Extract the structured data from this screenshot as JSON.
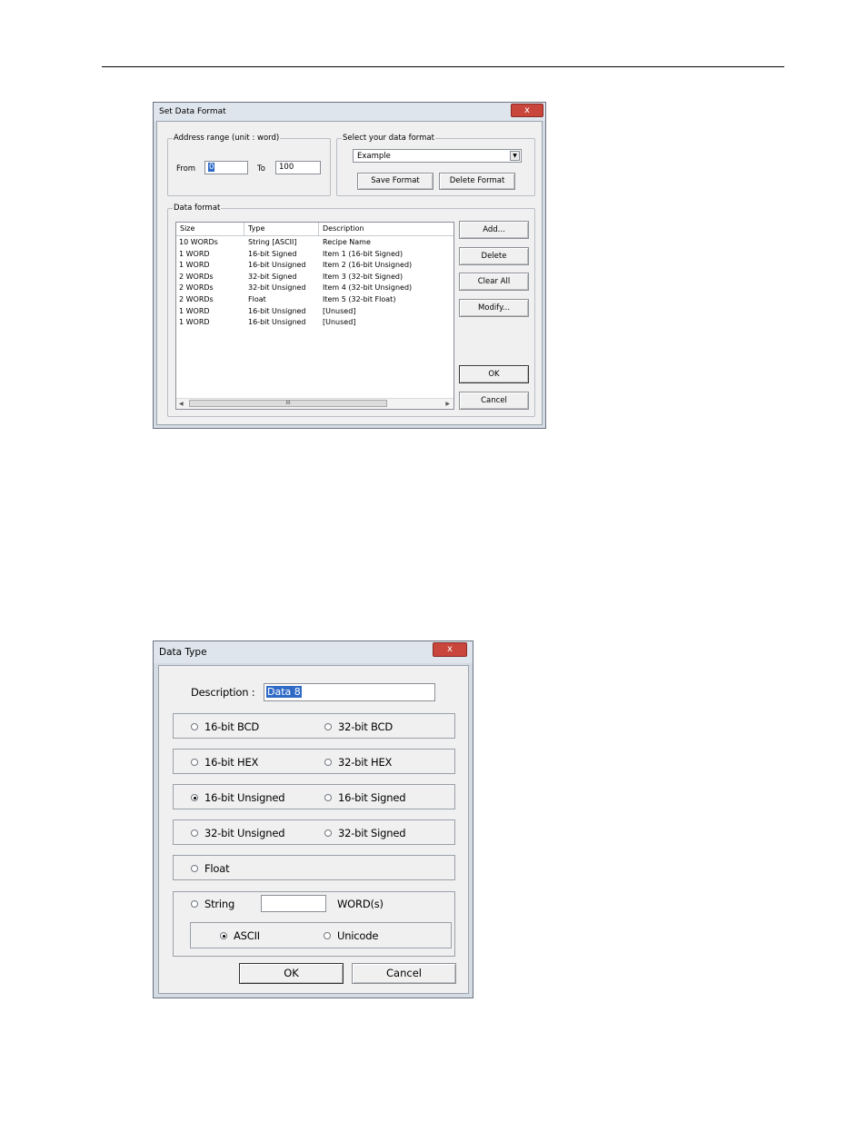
{
  "set_data_format": {
    "title": "Set Data Format",
    "close_label": "x",
    "address_range": {
      "legend": "Address range (unit : word)",
      "from_label": "From",
      "from_value": "0",
      "to_label": "To",
      "to_value": "100"
    },
    "select_format": {
      "legend": "Select your data format",
      "selected": "Example",
      "save_label": "Save Format",
      "delete_label": "Delete Format"
    },
    "data_format": {
      "legend": "Data format",
      "columns": [
        "Size",
        "Type",
        "Description"
      ],
      "rows": [
        [
          "10 WORDs",
          "String [ASCII]",
          "Recipe Name"
        ],
        [
          "1 WORD",
          "16-bit Signed",
          "Item 1 (16-bit Signed)"
        ],
        [
          "1 WORD",
          "16-bit Unsigned",
          "Item 2 (16-bit Unsigned)"
        ],
        [
          "2 WORDs",
          "32-bit Signed",
          "Item 3 (32-bit Signed)"
        ],
        [
          "2 WORDs",
          "32-bit Unsigned",
          "Item 4 (32-bit Unsigned)"
        ],
        [
          "2 WORDs",
          "Float",
          "Item 5 (32-bit Float)"
        ],
        [
          "1 WORD",
          "16-bit Unsigned",
          "[Unused]"
        ],
        [
          "1 WORD",
          "16-bit Unsigned",
          "[Unused]"
        ]
      ],
      "scroll_thumb": "III"
    },
    "buttons": {
      "add": "Add...",
      "delete": "Delete",
      "clear_all": "Clear All",
      "modify": "Modify...",
      "ok": "OK",
      "cancel": "Cancel"
    }
  },
  "data_type": {
    "title": "Data Type",
    "close_label": "x",
    "description_label": "Description :",
    "description_value": "Data 8",
    "options": {
      "bcd16": "16-bit BCD",
      "bcd32": "32-bit BCD",
      "hex16": "16-bit HEX",
      "hex32": "32-bit HEX",
      "unsigned16": "16-bit Unsigned",
      "signed16": "16-bit Signed",
      "unsigned32": "32-bit Unsigned",
      "signed32": "32-bit Signed",
      "float": "Float",
      "string": "String",
      "words_label": "WORD(s)",
      "string_length": "",
      "ascii": "ASCII",
      "unicode": "Unicode"
    },
    "selected_type": "16-bit Unsigned",
    "selected_encoding": "ASCII",
    "ok_label": "OK",
    "cancel_label": "Cancel"
  }
}
